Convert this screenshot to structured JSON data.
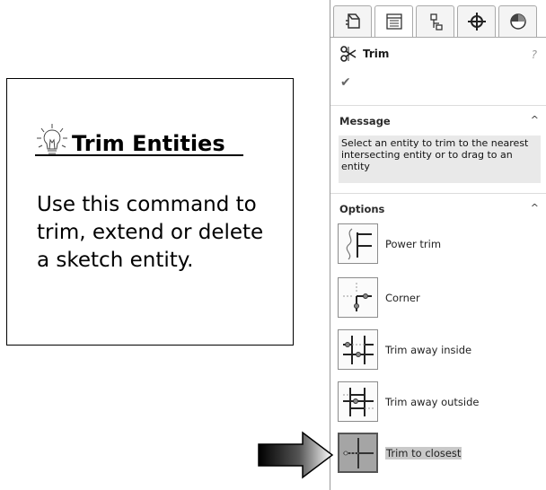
{
  "callout": {
    "title": "Trim Entities",
    "body": "Use this command to trim, extend or delete a sketch entity."
  },
  "panel": {
    "tabs": [
      {
        "icon": "feature-manager-icon"
      },
      {
        "icon": "property-manager-icon"
      },
      {
        "icon": "configuration-manager-icon"
      },
      {
        "icon": "dimxpert-manager-icon"
      },
      {
        "icon": "display-manager-icon"
      }
    ],
    "title": "Trim",
    "help": "?",
    "ok": "✔",
    "message_group": {
      "title": "Message",
      "chevron": "^",
      "text": "Select an entity to trim to the nearest intersecting entity or to drag to an entity"
    },
    "options_group": {
      "title": "Options",
      "chevron": "^",
      "items": [
        {
          "label": "Power trim",
          "icon": "power-trim-icon"
        },
        {
          "label": "Corner",
          "icon": "corner-icon"
        },
        {
          "label": "Trim away inside",
          "icon": "trim-away-inside-icon"
        },
        {
          "label": "Trim away outside",
          "icon": "trim-away-outside-icon"
        },
        {
          "label": "Trim to closest",
          "icon": "trim-to-closest-icon",
          "selected": true
        }
      ]
    }
  }
}
